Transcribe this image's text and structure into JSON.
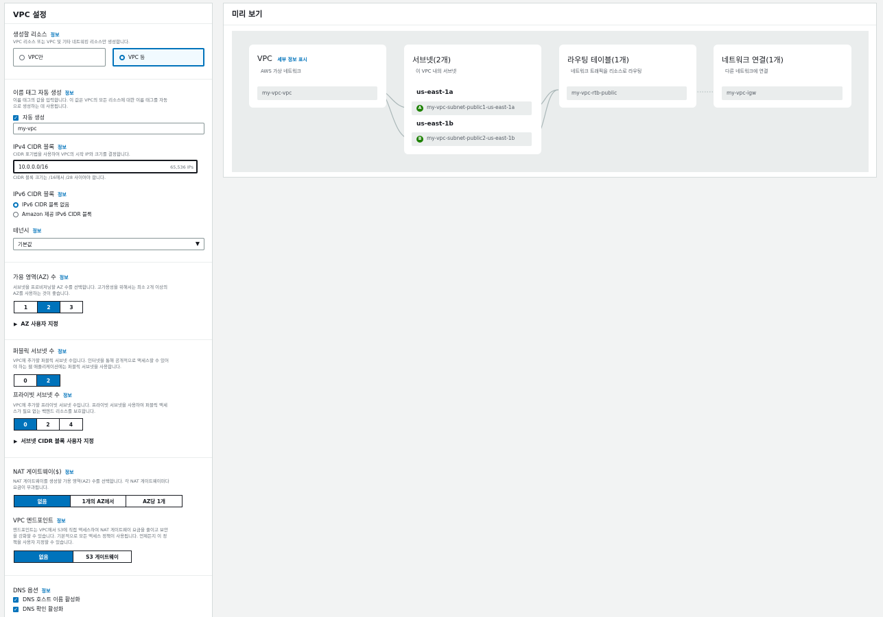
{
  "settings": {
    "title": "VPC 설정",
    "info": "정보",
    "resources": {
      "label": "생성할 리소스",
      "desc": "VPC 리소스 또는 VPC 및 기타 네트워킹 리소스만 생성합니다.",
      "opt_vpc_only": "VPC만",
      "opt_vpc_more": "VPC 등"
    },
    "name_tag": {
      "label": "이름 태그 자동 생성",
      "desc1": "이름 태그의 값을 입력합니다. 이 값은 VPC의 모든 리소스에 대한 이름 태그를 자동",
      "desc2": "으로 생성하는 데 사용됩니다.",
      "auto_label": "자동 생성",
      "value": "my-vpc"
    },
    "ipv4": {
      "label": "IPv4 CIDR 블록",
      "desc": "CIDR 표기법을 사용하여 VPC의 시작 IP와 크기를 결정합니다.",
      "value": "10.0.0.0/16",
      "ips": "65,536 IPs",
      "hint": "CIDR 블록 크기는 /16에서 /28 사이여야 합니다."
    },
    "ipv6": {
      "label": "IPv6 CIDR 블록",
      "opt_none": "IPv6 CIDR 블록 없음",
      "opt_amazon": "Amazon 제공 IPv6 CIDR 블록"
    },
    "tenancy": {
      "label": "테넌시",
      "value": "기본값"
    },
    "az": {
      "label": "가용 영역(AZ) 수",
      "desc1": "서브넷을 프로비저닝할 AZ 수를 선택합니다. 고가용성을 위해서는 최소 2개 이상의",
      "desc2": "AZ를 사용하는 것이 좋습니다.",
      "options": [
        "1",
        "2",
        "3"
      ],
      "customize": "AZ 사용자 지정"
    },
    "public_subnets": {
      "label": "퍼블릭 서브넷 수",
      "desc1": "VPC에 추가할 퍼블릭 서브넷 수입니다. 인터넷을 통해 공개적으로 액세스할 수 있어",
      "desc2": "야 하는 웹 애플리케이션에는 퍼블릭 서브넷을 사용합니다.",
      "options": [
        "0",
        "2"
      ]
    },
    "private_subnets": {
      "label": "프라이빗 서브넷 수",
      "desc1": "VPC에 추가할 프라이빗 서브넷 수입니다. 프라이빗 서브넷을 사용하여 퍼블릭 액세",
      "desc2": "스가 필요 없는 백엔드 리소스를 보호합니다.",
      "options": [
        "0",
        "2",
        "4"
      ],
      "customize": "서브넷 CIDR 블록 사용자 지정"
    },
    "nat": {
      "label": "NAT 게이트웨이($)",
      "desc1": "NAT 게이트웨이를 생성할 가용 영역(AZ) 수를 선택합니다. 각 NAT 게이트웨이마다",
      "desc2": "요금이 부과됩니다.",
      "options": [
        "없음",
        "1개의 AZ에서",
        "AZ당 1개"
      ]
    },
    "endpoints": {
      "label": "VPC 엔드포인트",
      "desc1": "엔드포인트는 VPC에서 S3에 직접 액세스하여 NAT 게이트웨이 요금을 줄이고 보안",
      "desc2": "을 강화할 수 있습니다. 기본적으로 모든 액세스 정책이 사용됩니다. 언제든지 이 정",
      "desc3": "책을 사용자 지정할 수 있습니다.",
      "options": [
        "없음",
        "S3 게이트웨이"
      ]
    },
    "dns": {
      "label": "DNS 옵션",
      "opt_hostnames": "DNS 호스트 이름 활성화",
      "opt_resolution": "DNS 확인 활성화"
    }
  },
  "preview": {
    "title": "미리 보기",
    "vpc": {
      "title": "VPC",
      "link": "세부 정보 표시",
      "sub": "AWS 가상 네트워크",
      "item": "my-vpc-vpc"
    },
    "subnets": {
      "title": "서브넷(2개)",
      "sub": "이 VPC 내의 서브넷",
      "az1": "us-east-1a",
      "az2": "us-east-1b",
      "subnet1": "my-vpc-subnet-public1-us-east-1a",
      "subnet2": "my-vpc-subnet-public2-us-east-1b",
      "badge1": "A",
      "badge2": "B"
    },
    "route_tables": {
      "title": "라우팅 테이블(1개)",
      "sub": "네트워크 트래픽을 리소스로 라우팅",
      "item": "my-vpc-rtb-public"
    },
    "network": {
      "title": "네트워크 연결(1개)",
      "sub": "다른 네트워크에 연결",
      "item": "my-vpc-igw"
    }
  },
  "colors": {
    "accent": "#0073bb",
    "subnet_badge": "#1d8102",
    "canvas_bg": "#eaeded"
  }
}
